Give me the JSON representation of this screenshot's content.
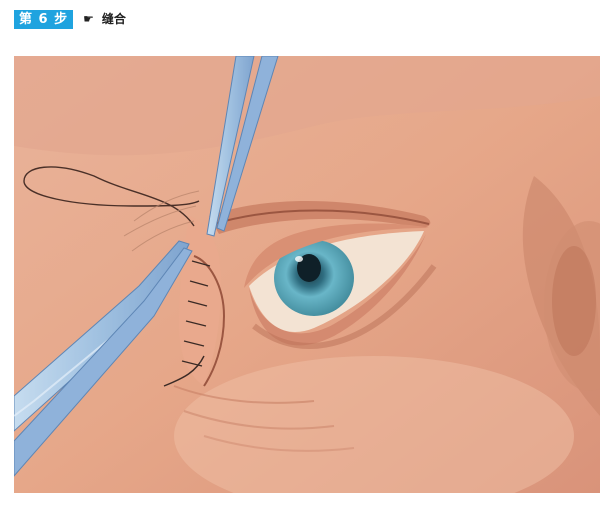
{
  "step": {
    "badge": "第 6 步",
    "icon": "pointing-hand-icon",
    "glyph": "☛",
    "title": "缝合"
  },
  "illustration": {
    "subject": "eyelid-suture-illustration"
  },
  "colors": {
    "badge": "#1fa3df",
    "skin": "#e7a88f",
    "iris": "#69b6c8",
    "instrument": "#a8c8e8"
  }
}
